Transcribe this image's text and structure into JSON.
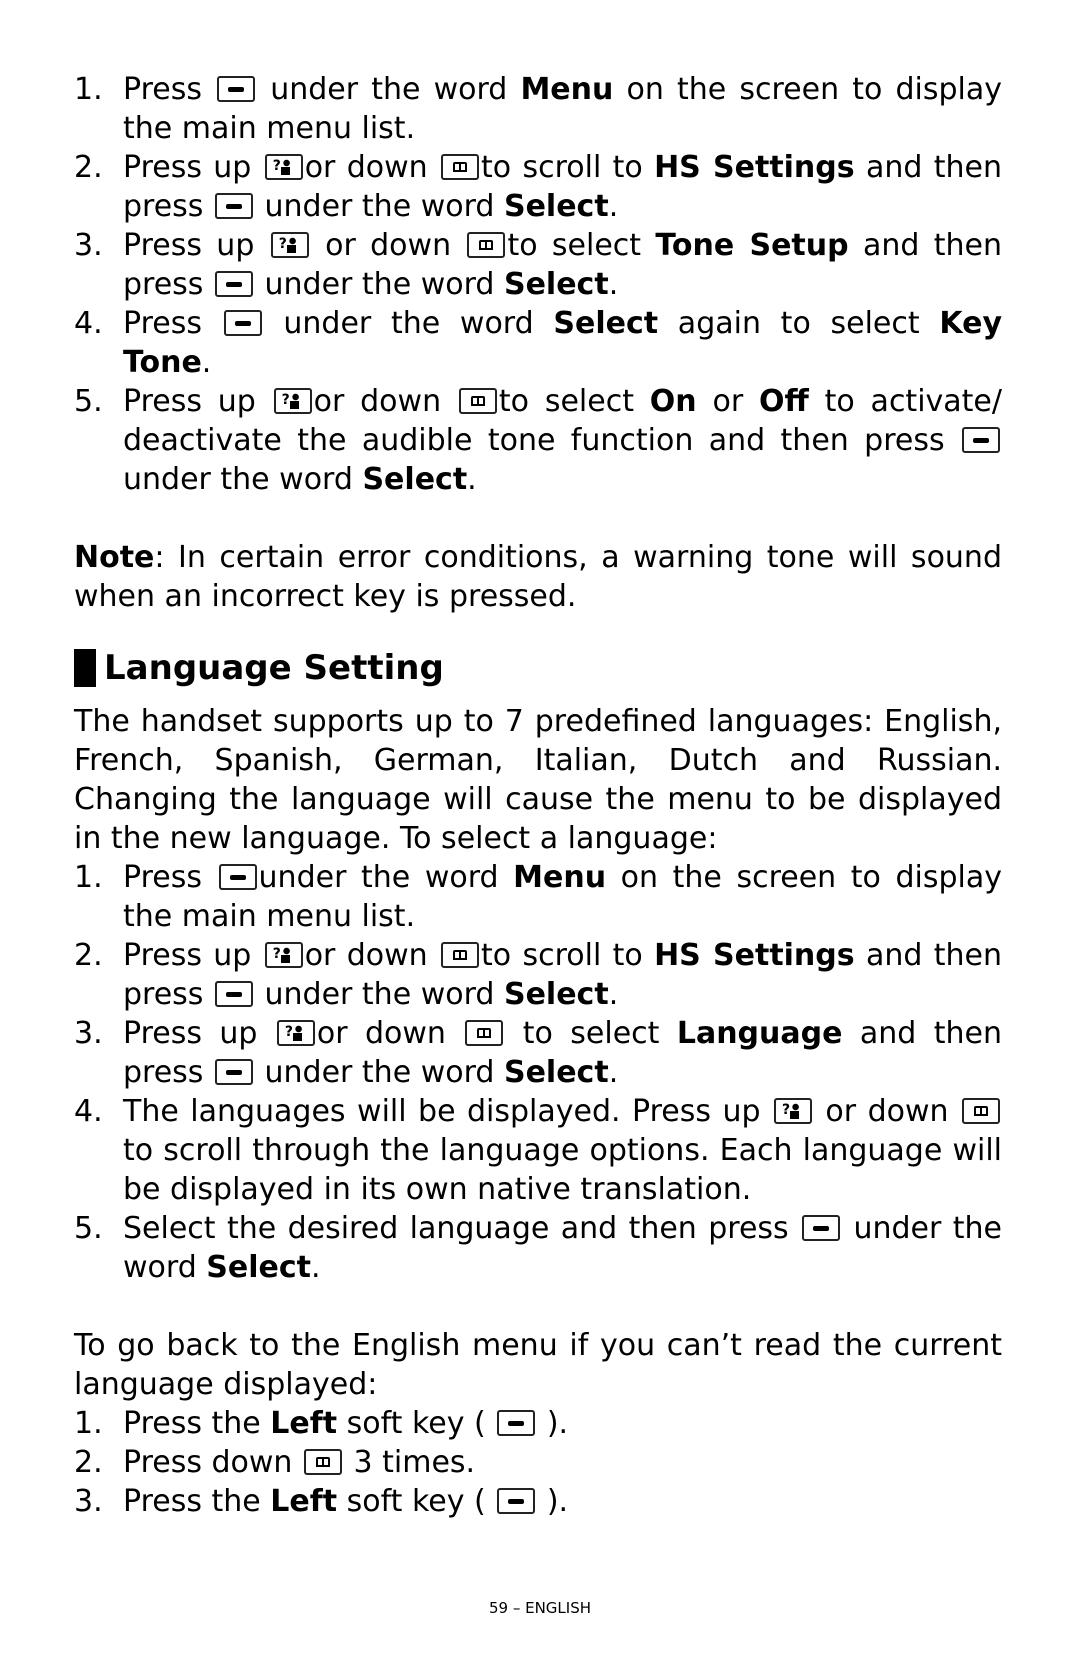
{
  "section1": {
    "steps": [
      {
        "num": "1.",
        "parts": [
          "Press ",
          "[soft]",
          " under the word ",
          "**Menu**",
          " on the screen to display the main menu list."
        ]
      },
      {
        "num": "2.",
        "parts": [
          "Press up ",
          "[up]",
          "or down ",
          "[down]",
          "to scroll to ",
          "**HS Settings**",
          " and then press ",
          "[soft]",
          " under the word ",
          "**Select**",
          "."
        ]
      },
      {
        "num": "3.",
        "parts": [
          "Press up ",
          "[up]",
          " or down ",
          "[down]",
          "to select ",
          "**Tone Setup**",
          " and then press ",
          "[soft]",
          " under the word ",
          "**Select**",
          "."
        ]
      },
      {
        "num": "4.",
        "parts": [
          "Press ",
          "[soft]",
          " under the word ",
          "**Select**",
          " again to select ",
          "**Key Tone**",
          "."
        ]
      },
      {
        "num": "5.",
        "parts": [
          "Press up ",
          "[up]",
          "or down ",
          "[down]",
          "to select ",
          "**On**",
          " or ",
          "**Off**",
          " to activate/ deactivate the audible tone function and then press ",
          "[soft]",
          " under the word ",
          "**Select**",
          "."
        ]
      }
    ],
    "note_label": "Note",
    "note_text": ": In certain error conditions, a warning tone will sound when an incorrect key is pressed."
  },
  "section2": {
    "heading": "Language Setting",
    "intro": "The handset supports up to 7 predefined languages: English, French, Spanish, German, Italian, Dutch and Russian.  Changing the language will cause the menu to be displayed in the new language.  To select a language:",
    "steps": [
      {
        "num": "1.",
        "parts": [
          "Press ",
          "[soft]",
          "under the word ",
          "**Menu**",
          " on the screen to display the main menu list."
        ]
      },
      {
        "num": "2.",
        "parts": [
          "Press up ",
          "[up]",
          "or down ",
          "[down]",
          "to scroll to ",
          "**HS Settings**",
          " and then press ",
          "[soft]",
          " under the word ",
          "**Select**",
          "."
        ]
      },
      {
        "num": "3.",
        "parts": [
          "Press up ",
          "[up]",
          "or down ",
          "[down]",
          " to select ",
          "**Language**",
          " and then press ",
          "[soft]",
          " under the word ",
          "**Select**",
          "."
        ]
      },
      {
        "num": "4.",
        "parts": [
          "The languages will be displayed. Press up ",
          "[up]",
          " or down ",
          "[down]",
          " to scroll through the language options. Each language will be displayed in its own native translation."
        ]
      },
      {
        "num": "5.",
        "parts": [
          "Select the desired language and then press ",
          "[soft]",
          " under the word ",
          "**Select**",
          "."
        ]
      }
    ],
    "back_intro": "To go back to the English menu if you can’t read the current language displayed:",
    "back_steps": [
      {
        "num": "1.",
        "parts": [
          "Press the ",
          "**Left**",
          " soft key ( ",
          "[soft]",
          " )."
        ]
      },
      {
        "num": "2.",
        "parts": [
          "Press down ",
          "[down]",
          " 3 times."
        ]
      },
      {
        "num": "3.",
        "parts": [
          "Press the ",
          "**Left**",
          " soft key ( ",
          "[soft]",
          " )."
        ]
      }
    ]
  },
  "icons": {
    "soft": "soft-key-icon",
    "up": "up-key-icon",
    "down": "down-key-icon"
  },
  "footer": "59 – ENGLISH"
}
